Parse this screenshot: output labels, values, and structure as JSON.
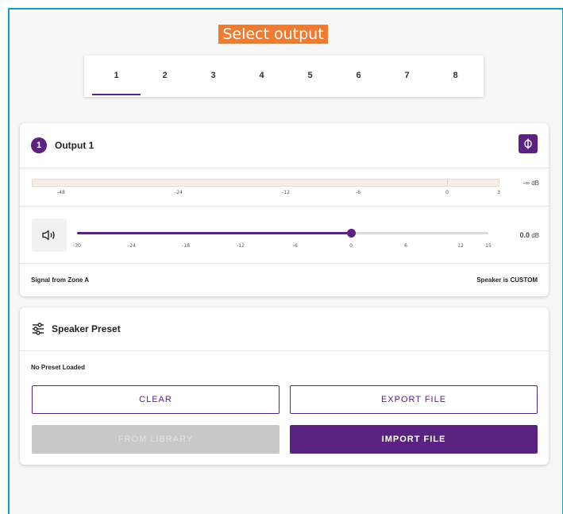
{
  "header": {
    "select_label": "Select output"
  },
  "tabs": [
    {
      "label": "1"
    },
    {
      "label": "2"
    },
    {
      "label": "3"
    },
    {
      "label": "4"
    },
    {
      "label": "5"
    },
    {
      "label": "6"
    },
    {
      "label": "7"
    },
    {
      "label": "8"
    }
  ],
  "active_tab": 0,
  "output": {
    "number": "1",
    "title": "Output 1",
    "phase_icon": "phase-icon",
    "meter": {
      "ticks": [
        "-48",
        "-24",
        "-12",
        "-6",
        "0",
        "3"
      ],
      "value_symbol": "-∞",
      "value_unit": "dB"
    },
    "gain": {
      "ticks": [
        "-30",
        "-24",
        "-18",
        "-12",
        "-6",
        "0",
        "6",
        "12",
        "15"
      ],
      "value": "0.0",
      "unit": "dB",
      "min": -30,
      "max": 15,
      "current": 0
    },
    "signal_source": "Signal from Zone A",
    "speaker_status": "Speaker is CUSTOM"
  },
  "preset": {
    "title": "Speaker Preset",
    "status": "No Preset Loaded",
    "buttons": {
      "clear": "CLEAR",
      "export": "EXPORT FILE",
      "library": "FROM LIBRARY",
      "import": "IMPORT FILE"
    }
  },
  "colors": {
    "accent": "#5a2382",
    "frame": "#0aa3c7",
    "label_bg": "#f07a2f"
  }
}
